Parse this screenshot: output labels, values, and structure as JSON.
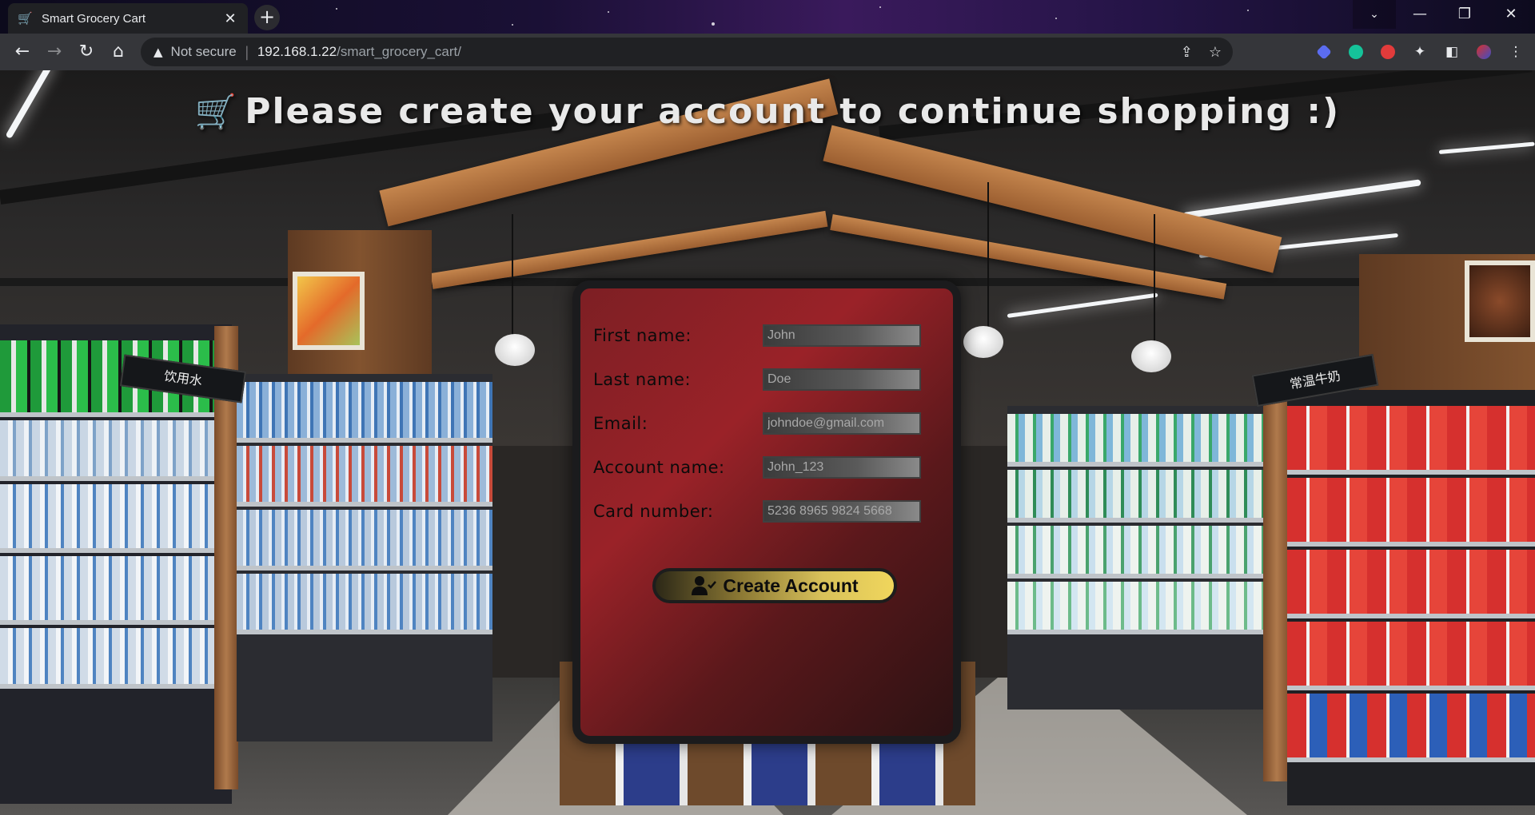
{
  "browser": {
    "tab_title": "Smart Grocery Cart",
    "new_tab": "+",
    "window": {
      "dropdown": "⌄",
      "minimize": "—",
      "maximize": "❐",
      "close": "✕"
    },
    "security_label": "Not secure",
    "url_host": "192.168.1.22",
    "url_path": "/smart_grocery_cart/",
    "icons": [
      "back-icon",
      "forward-icon",
      "reload-icon",
      "home-icon",
      "share-icon",
      "bookmark-star-icon",
      "extensions-icon",
      "side-panel-icon",
      "menu-icon"
    ]
  },
  "page": {
    "heading": "Please create your account to continue shopping :)",
    "form": {
      "fields": [
        {
          "label": "First name:",
          "placeholder": "John"
        },
        {
          "label": "Last name:",
          "placeholder": "Doe"
        },
        {
          "label": "Email:",
          "placeholder": "johndoe@gmail.com"
        },
        {
          "label": "Account name:",
          "placeholder": "John_123"
        },
        {
          "label": "Card number:",
          "placeholder": "5236 8965 9824 5668"
        }
      ],
      "submit_label": "Create Account"
    },
    "signs": {
      "left": "饮用水",
      "right": "常温牛奶"
    },
    "colors": {
      "card": "#8a2025",
      "button": "#e3c95a",
      "heading": "#e9e9e9"
    }
  }
}
